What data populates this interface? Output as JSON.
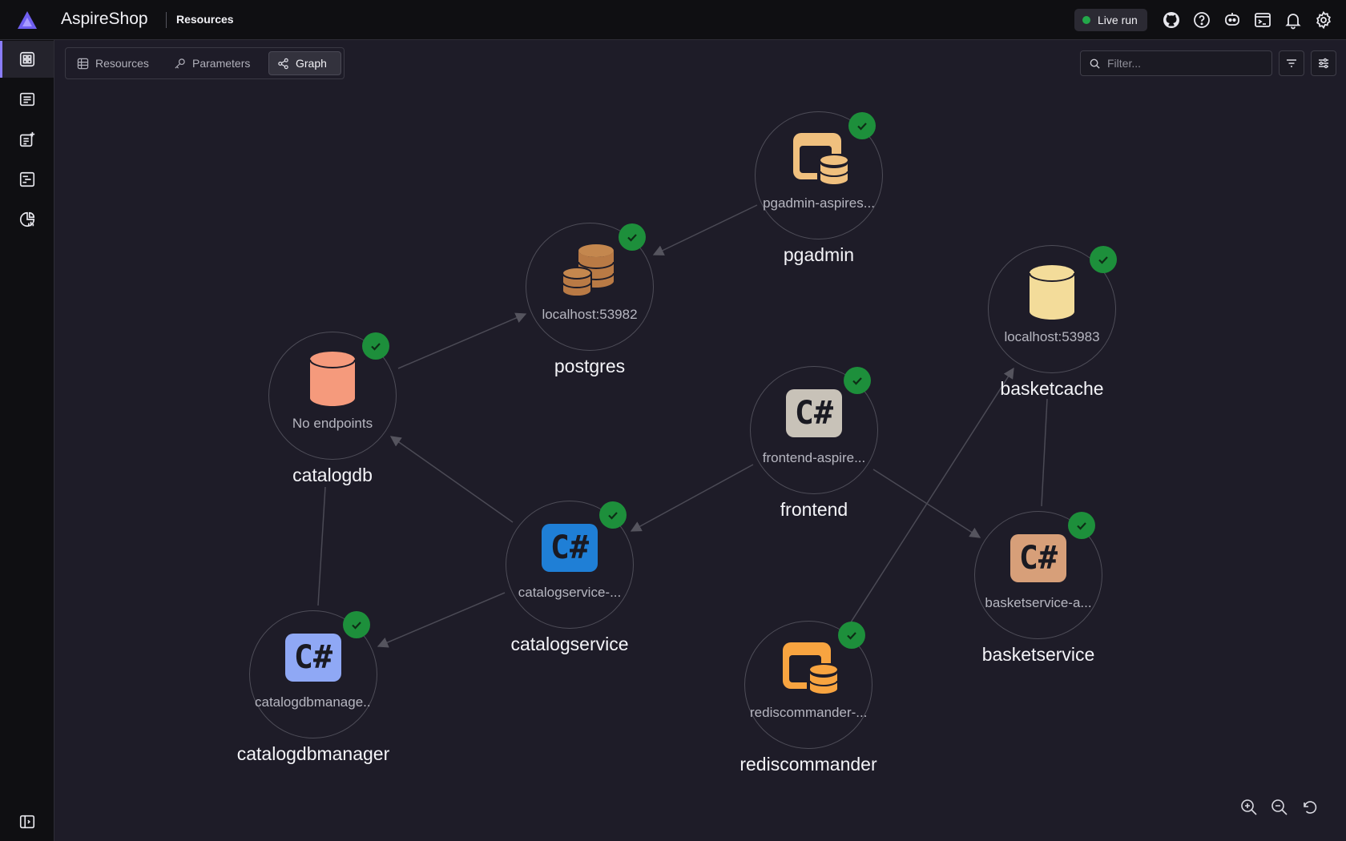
{
  "header": {
    "app_title": "AspireShop",
    "page": "Resources",
    "live_run": "Live run"
  },
  "toolbar": {
    "tabs": [
      {
        "label": "Resources",
        "icon": "table-icon"
      },
      {
        "label": "Parameters",
        "icon": "key-icon"
      },
      {
        "label": "Graph",
        "icon": "share-icon"
      }
    ],
    "active_tab": "Graph",
    "filter_placeholder": "Filter..."
  },
  "nodes": {
    "pgadmin": {
      "name": "pgadmin",
      "endpoint": "pgadmin-aspires...",
      "status": "running",
      "icon": "container-database-icon"
    },
    "postgres": {
      "name": "postgres",
      "endpoint": "localhost:53982",
      "status": "running",
      "icon": "database-stack-icon"
    },
    "basketcache": {
      "name": "basketcache",
      "endpoint": "localhost:53983",
      "status": "running",
      "icon": "database-icon"
    },
    "catalogdb": {
      "name": "catalogdb",
      "endpoint": "No endpoints",
      "status": "running",
      "icon": "database-icon"
    },
    "frontend": {
      "name": "frontend",
      "endpoint": "frontend-aspire...",
      "status": "running",
      "icon": "csharp-project-icon"
    },
    "catalogservice": {
      "name": "catalogservice",
      "endpoint": "catalogservice-...",
      "status": "running",
      "icon": "csharp-project-icon"
    },
    "basketservice": {
      "name": "basketservice",
      "endpoint": "basketservice-a...",
      "status": "running",
      "icon": "csharp-project-icon"
    },
    "catalogdbmanager": {
      "name": "catalogdbmanager",
      "endpoint": "catalogdbmanage...",
      "status": "running",
      "icon": "csharp-project-icon"
    },
    "rediscommander": {
      "name": "rediscommander",
      "endpoint": "rediscommander-...",
      "status": "running",
      "icon": "container-database-icon"
    }
  },
  "csharp_glyph": "C#",
  "colors": {
    "accent": "#8a7dfb",
    "status_ok": "#1d8f3b",
    "catalogdb": "#f59a7c",
    "postgres": "#b97a45",
    "basketcache": "#f3dc9a",
    "pgadmin": "#f0c07e",
    "rediscommander": "#f8a440",
    "frontend_cs": "#c8c2b8",
    "catalogservice_cs": "#1f7fd6",
    "basketservice_cs": "#d79f79",
    "catalogdbmanager_cs": "#8fa8f5"
  }
}
